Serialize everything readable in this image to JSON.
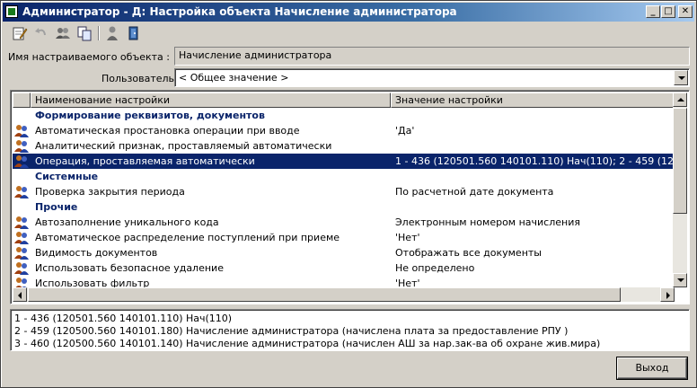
{
  "window": {
    "title": "Администратор - Д: Настройка объекта Начисление администратора",
    "controls": {
      "minimize": "_",
      "maximize": "□",
      "close": "✕"
    }
  },
  "toolbar": {
    "icons": [
      "edit-icon",
      "undo-icon",
      "users-icon",
      "copy-icon",
      "user-icon",
      "exit-door-icon"
    ]
  },
  "form": {
    "object_label": "Имя настраиваемого объекта :",
    "object_value": "Начисление администратора",
    "user_label": "Пользователь :",
    "user_value": "< Общее значение >"
  },
  "grid": {
    "columns": [
      "Наименование настройки",
      "Значение настройки"
    ],
    "rows": [
      {
        "type": "group",
        "name": "Формирование реквизитов, документов",
        "value": ""
      },
      {
        "type": "item",
        "icon": "users-icon",
        "name": "Автоматическая простановка операции при вводе",
        "value": "'Да'"
      },
      {
        "type": "item",
        "icon": "users-icon",
        "name": "Аналитический признак, проставляемый автоматически",
        "value": ""
      },
      {
        "type": "item",
        "icon": "users-icon",
        "name": "Операция, проставляемая автоматически",
        "value": "1 - 436 (120501.560 140101.110) Нач(110); 2 - 459 (1205",
        "selected": true
      },
      {
        "type": "group",
        "name": "Системные",
        "value": ""
      },
      {
        "type": "item",
        "icon": "users-icon",
        "name": "Проверка закрытия периода",
        "value": "По расчетной дате документа"
      },
      {
        "type": "group",
        "name": "Прочие",
        "value": ""
      },
      {
        "type": "item",
        "icon": "users-icon",
        "name": "Автозаполнение уникального кода",
        "value": "Электронным номером начисления"
      },
      {
        "type": "item",
        "icon": "users-icon",
        "name": "Автоматическое распределение поступлений при приеме",
        "value": "'Нет'"
      },
      {
        "type": "item",
        "icon": "users-icon",
        "name": "Видимость документов",
        "value": "Отображать все документы"
      },
      {
        "type": "item",
        "icon": "users-icon",
        "name": "Использовать безопасное удаление",
        "value": "Не определено"
      },
      {
        "type": "item",
        "icon": "users-icon",
        "name": "Использовать фильтр",
        "value": "'Нет'"
      }
    ]
  },
  "memo": {
    "lines": [
      "1 - 436 (120501.560 140101.110) Нач(110)",
      "2 - 459 (120500.560 140101.180) Начисление администратора (начислена плата за предоставление  РПУ )",
      "3 - 460 (120500.560 140101.140) Начисление администратора (начислен АШ за нар.зак-ва об охране жив.мира)"
    ]
  },
  "buttons": {
    "exit": "Выход"
  },
  "colors": {
    "titlebar": "#0a246a",
    "selection": "#0a246a",
    "group_text": "#0a246a",
    "face": "#d4d0c8"
  }
}
